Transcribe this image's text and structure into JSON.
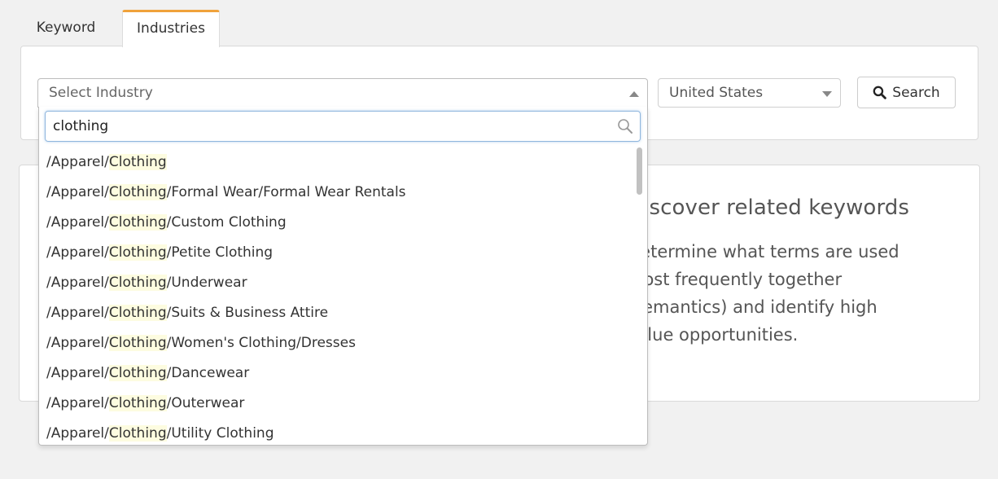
{
  "tabs": {
    "keyword": "Keyword",
    "industries": "Industries"
  },
  "industry_select": {
    "placeholder": "Select Industry",
    "search_value": "clothing",
    "query_highlight": "Clothing"
  },
  "country_select": {
    "value": "United States"
  },
  "search_button": {
    "label": "Search"
  },
  "results": [
    {
      "prefix": "/Apparel/",
      "match": "Clothing",
      "suffix": ""
    },
    {
      "prefix": "/Apparel/",
      "match": "Clothing",
      "suffix": "/Formal Wear/Formal Wear Rentals"
    },
    {
      "prefix": "/Apparel/",
      "match": "Clothing",
      "suffix": "/Custom Clothing"
    },
    {
      "prefix": "/Apparel/",
      "match": "Clothing",
      "suffix": "/Petite Clothing"
    },
    {
      "prefix": "/Apparel/",
      "match": "Clothing",
      "suffix": "/Underwear"
    },
    {
      "prefix": "/Apparel/",
      "match": "Clothing",
      "suffix": "/Suits & Business Attire"
    },
    {
      "prefix": "/Apparel/",
      "match": "Clothing",
      "suffix": "/Women's Clothing/Dresses"
    },
    {
      "prefix": "/Apparel/",
      "match": "Clothing",
      "suffix": "/Dancewear"
    },
    {
      "prefix": "/Apparel/",
      "match": "Clothing",
      "suffix": "/Outerwear"
    },
    {
      "prefix": "/Apparel/",
      "match": "Clothing",
      "suffix": "/Utility Clothing"
    }
  ],
  "discover": {
    "title": "Discover related keywords",
    "body": "Determine what terms are used most frequently together (semantics) and identify high value opportunities."
  },
  "icons": {
    "search_button_icon": "search-icon",
    "search_field_icon": "search-icon",
    "industry_toggle": "triangle-up-icon",
    "country_toggle": "triangle-down-icon"
  },
  "colors": {
    "active_tab_accent": "#f0a23b",
    "match_highlight": "#fdfce0",
    "focus_border": "#8fb6dd"
  }
}
